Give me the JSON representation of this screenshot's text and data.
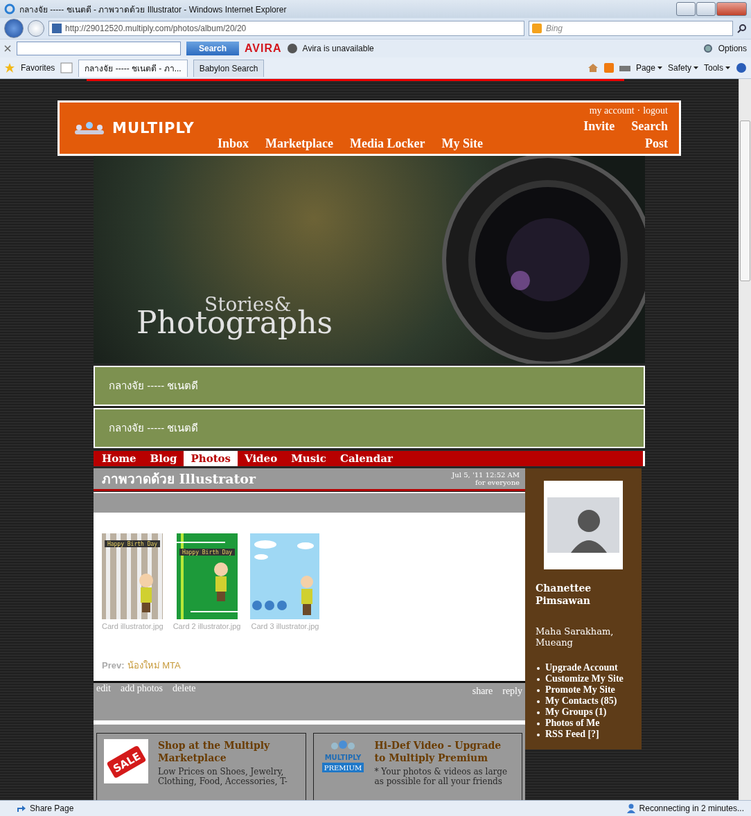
{
  "browser": {
    "title": "กลางจัย ----- ชเนตดี - ภาพวาดด้วย Illustrator - Windows Internet Explorer",
    "address": "http://29012520.multiply.com/photos/album/20/20",
    "search_engine": "Bing",
    "toolbar_search": "Search",
    "avira_logo": "AVIRA",
    "avira_status": "Avira is unavailable",
    "options": "Options",
    "favorites": "Favorites",
    "tabs": [
      {
        "label": "กลางจัย ----- ชเนตดี - ภา...",
        "selected": true
      },
      {
        "label": "Babylon Search",
        "selected": false
      }
    ],
    "commands": [
      "Page",
      "Safety",
      "Tools"
    ]
  },
  "site": {
    "logo": "MULTIPLY",
    "account_links": [
      "my account",
      "logout"
    ],
    "account_separator": "·",
    "top_links": [
      "Invite",
      "Search"
    ],
    "nav": [
      "Inbox",
      "Marketplace",
      "Media Locker",
      "My Site"
    ],
    "post_link": "Post",
    "banner": {
      "small": "Stories&",
      "big": "Photographs"
    },
    "site_titles": [
      "กลางจัย ----- ชเนตดี",
      "กลางจัย ----- ชเนตดี"
    ],
    "tabs": [
      {
        "label": "Home",
        "selected": false
      },
      {
        "label": "Blog",
        "selected": false
      },
      {
        "label": "Photos",
        "selected": true
      },
      {
        "label": "Video",
        "selected": false
      },
      {
        "label": "Music",
        "selected": false
      },
      {
        "label": "Calendar",
        "selected": false
      }
    ],
    "post": {
      "title": "ภาพวาดด้วย Illustrator",
      "date": "Jul 5, '11 12:52 AM",
      "visibility": "for everyone"
    },
    "photos": [
      {
        "kind": "stripes",
        "banner": "Happy Birth Day",
        "caption": "Card illustrator.jpg"
      },
      {
        "kind": "green",
        "banner": "Happy Birth Day",
        "caption": "Card 2 illustrator.jpg"
      },
      {
        "kind": "sky",
        "caption": "Card 3 illustrator.jpg"
      }
    ],
    "prev": {
      "label": "Prev:",
      "link": "น้องใหม่ MTA"
    },
    "actions_left": [
      "edit",
      "add photos",
      "delete"
    ],
    "actions_right": [
      "share",
      "reply"
    ],
    "ads": [
      {
        "kind": "sale",
        "badge": "SALE",
        "title": "Shop at the Multiply Marketplace",
        "text": "Low Prices on Shoes, Jewelry, Clothing, Food, Accessories, T-"
      },
      {
        "kind": "premium",
        "badge": "PREMIUM",
        "brand": "MULTIPLY",
        "title": "Hi-Def Video - Upgrade to Multiply Premium",
        "text": "* Your photos & videos as large as possible for all your friends"
      }
    ],
    "profile": {
      "name": "Chanettee Pimsawan",
      "location": "Maha Sarakham, Mueang",
      "links": [
        "Upgrade Account",
        "Customize My Site",
        "Promote My Site",
        "My Contacts (85)",
        "My Groups (1)",
        "Photos of Me",
        "RSS Feed [?]"
      ]
    }
  },
  "status_bar": {
    "share": "Share Page",
    "status": "Reconnecting in 2 minutes..."
  }
}
